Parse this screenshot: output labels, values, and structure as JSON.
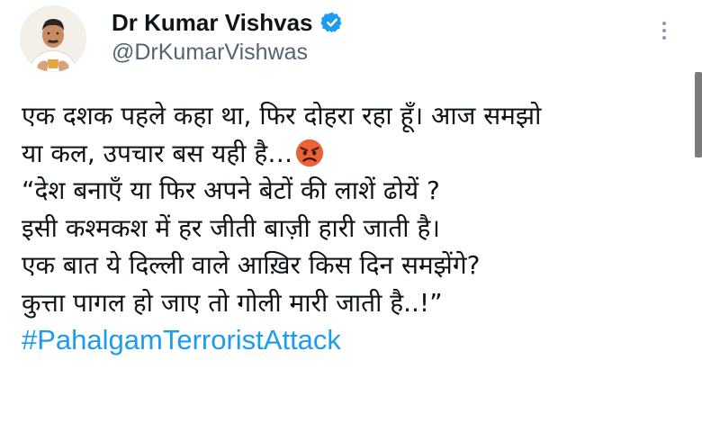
{
  "author": {
    "display_name": "Dr Kumar Vishvas",
    "handle": "@DrKumarVishwas",
    "verified": true
  },
  "icons": {
    "avatar": "profile-photo",
    "verified": "verified-badge-icon",
    "more": "more-options-icon",
    "emoji": "angry-face-emoji"
  },
  "colors": {
    "hashtag": "#1d9bf0",
    "verified": "#1d9bf0",
    "handle": "#536471",
    "text": "#0f1419"
  },
  "tweet": {
    "lines": [
      "एक दशक पहले कहा था, फिर दोहरा रहा हूँ। आज समझो",
      "या कल, उपचार बस यही है…",
      "“देश बनाएँ या फिर अपने बेटों की लाशें ढोयें ?",
      "इसी कश्मकश में हर जीती बाज़ी हारी जाती है।",
      "एक बात ये दिल्ली वाले आख़िर किस दिन समझेंगे?",
      "कुत्ता पागल हो जाए तो गोली मारी जाती है..!”"
    ],
    "hashtag": "#PahalgamTerroristAttack"
  }
}
